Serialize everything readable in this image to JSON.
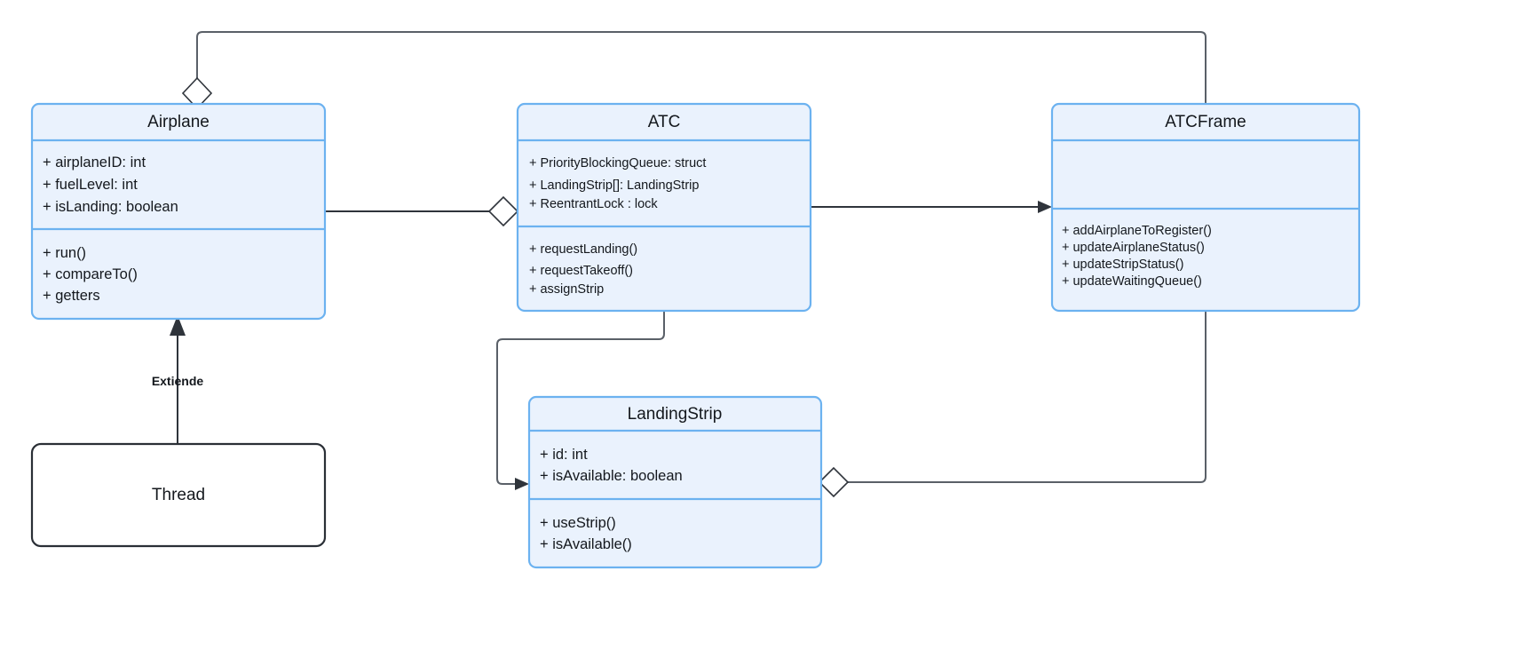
{
  "diagram": {
    "type": "uml-class-diagram",
    "background_color": "#ffffff",
    "class_fill_color": "#eaf2fd",
    "class_border_color": "#6cb2f0",
    "plain_border_color": "#2a2f36",
    "edge_color": "#2f343b"
  },
  "classes": {
    "airplane": {
      "name": "Airplane",
      "attributes": [
        "+ airplaneID: int",
        "+ fuelLevel: int",
        "+ isLanding: boolean"
      ],
      "methods": [
        "+ run()",
        "+ compareTo()",
        "+ getters"
      ]
    },
    "atc": {
      "name": "ATC",
      "attributes": [
        "+ PriorityBlockingQueue: struct",
        "+ LandingStrip[]: LandingStrip",
        "+ ReentrantLock : lock"
      ],
      "methods": [
        "+ requestLanding()",
        "+ requestTakeoff()",
        "+ assignStrip"
      ]
    },
    "atcframe": {
      "name": "ATCFrame",
      "attributes": [],
      "methods": [
        "+ addAirplaneToRegister()",
        "+ updateAirplaneStatus()",
        "+ updateStripStatus()",
        "+ updateWaitingQueue()"
      ]
    },
    "landingstrip": {
      "name": "LandingStrip",
      "attributes": [
        "+ id: int",
        "+ isAvailable: boolean"
      ],
      "methods": [
        "+ useStrip()",
        "+ isAvailable()"
      ]
    },
    "thread": {
      "name": "Thread",
      "attributes": [],
      "methods": []
    }
  },
  "relationships": [
    {
      "id": "atcframe-to-airplane",
      "from": "ATCFrame",
      "to": "Airplane",
      "kind": "aggregation",
      "label": ""
    },
    {
      "id": "airplane-to-atc",
      "from": "Airplane",
      "to": "ATC",
      "kind": "aggregation",
      "label": ""
    },
    {
      "id": "atc-to-atcframe",
      "from": "ATC",
      "to": "ATCFrame",
      "kind": "association-directed",
      "label": ""
    },
    {
      "id": "atc-to-landingstrip",
      "from": "ATC",
      "to": "LandingStrip",
      "kind": "association-directed",
      "label": ""
    },
    {
      "id": "landingstrip-to-atcframe",
      "from": "LandingStrip",
      "to": "ATCFrame",
      "kind": "aggregation",
      "label": ""
    },
    {
      "id": "thread-to-airplane",
      "from": "Thread",
      "to": "Airplane",
      "kind": "generalization",
      "label": "Extiende"
    }
  ],
  "labels": {
    "extiende": "Extiende"
  }
}
